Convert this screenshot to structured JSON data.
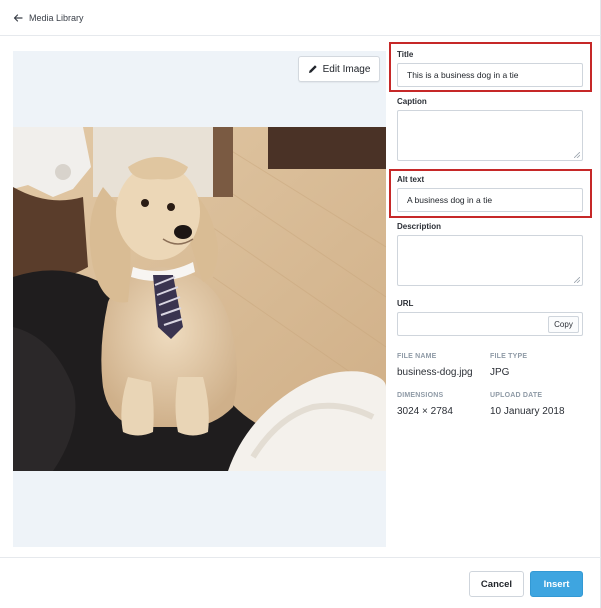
{
  "header": {
    "back_label": "Media Library"
  },
  "preview": {
    "edit_label": "Edit Image"
  },
  "fields": {
    "title": {
      "label": "Title",
      "value": "This is a business dog in a tie"
    },
    "caption": {
      "label": "Caption",
      "value": ""
    },
    "alt_text": {
      "label": "Alt text",
      "value": "A business dog in a tie"
    },
    "description": {
      "label": "Description",
      "value": ""
    },
    "url": {
      "label": "URL",
      "value": "",
      "copy_label": "Copy"
    }
  },
  "meta": {
    "file_name": {
      "label": "FILE NAME",
      "value": "business-dog.jpg"
    },
    "file_type": {
      "label": "FILE TYPE",
      "value": "JPG"
    },
    "dimensions": {
      "label": "DIMENSIONS",
      "value": "3024 × 2784"
    },
    "upload_date": {
      "label": "UPLOAD DATE",
      "value": "10 January 2018"
    }
  },
  "footer": {
    "cancel_label": "Cancel",
    "insert_label": "Insert"
  },
  "colors": {
    "accent": "#3ea5e0",
    "highlight": "#c62828"
  },
  "icons": {
    "back": "arrow-left-icon",
    "edit": "pencil-icon",
    "resize": "resize-grip-icon"
  }
}
